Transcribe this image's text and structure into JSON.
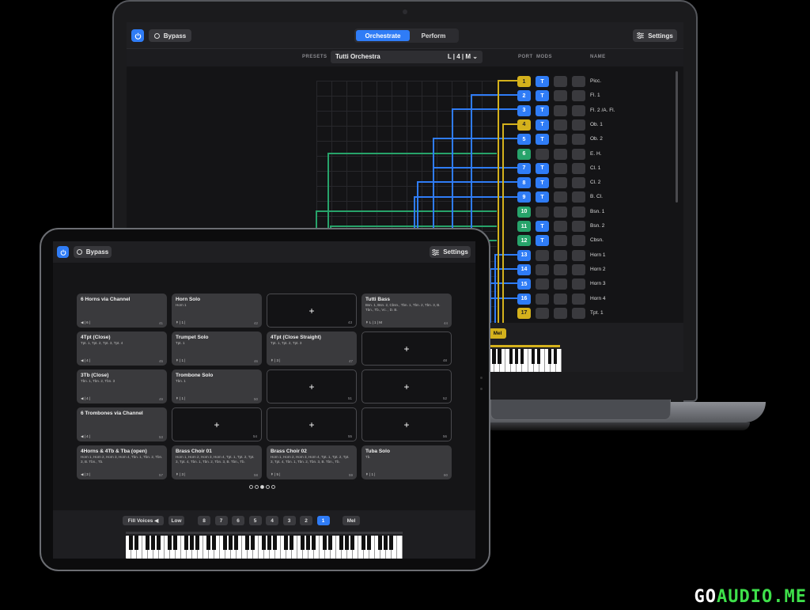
{
  "laptop": {
    "topbar": {
      "bypass_label": "Bypass",
      "tab_orchestrate": "Orchestrate",
      "tab_perform": "Perform",
      "settings_label": "Settings"
    },
    "subbar": {
      "presets_label": "PRESETS",
      "preset_name": "Tutti Orchestra",
      "preset_mode": "L | 4 | M",
      "col_port": "PORT",
      "col_mods": "MODS",
      "col_name": "NAME"
    },
    "rows": [
      {
        "port": "1",
        "color": "#d4b11c",
        "t": true,
        "name": "Picc."
      },
      {
        "port": "2",
        "color": "#2f7cf6",
        "t": true,
        "name": "Fl. 1"
      },
      {
        "port": "3",
        "color": "#2f7cf6",
        "t": true,
        "name": "Fl. 2 /A. Fl."
      },
      {
        "port": "4",
        "color": "#d4b11c",
        "t": true,
        "name": "Ob. 1"
      },
      {
        "port": "5",
        "color": "#2f7cf6",
        "t": true,
        "name": "Ob. 2"
      },
      {
        "port": "6",
        "color": "#27a36a",
        "t": false,
        "name": "E. H."
      },
      {
        "port": "7",
        "color": "#2f7cf6",
        "t": true,
        "name": "Cl. 1"
      },
      {
        "port": "8",
        "color": "#2f7cf6",
        "t": true,
        "name": "Cl. 2"
      },
      {
        "port": "9",
        "color": "#2f7cf6",
        "t": true,
        "name": "B. Cl."
      },
      {
        "port": "10",
        "color": "#27a36a",
        "t": false,
        "name": "Bsn. 1"
      },
      {
        "port": "11",
        "color": "#27a36a",
        "t": true,
        "name": "Bsn. 2"
      },
      {
        "port": "12",
        "color": "#27a36a",
        "t": true,
        "name": "Cbsn."
      },
      {
        "port": "13",
        "color": "#2f7cf6",
        "t": false,
        "name": "Horn 1"
      },
      {
        "port": "14",
        "color": "#2f7cf6",
        "t": false,
        "name": "Horn 2"
      },
      {
        "port": "15",
        "color": "#2f7cf6",
        "t": false,
        "name": "Horn 3"
      },
      {
        "port": "16",
        "color": "#2f7cf6",
        "t": false,
        "name": "Horn 4"
      },
      {
        "port": "17",
        "color": "#d4b11c",
        "t": false,
        "name": "Tpt. 1"
      }
    ],
    "mod_label": "T",
    "bottom": {
      "mel_label": "Mel"
    }
  },
  "tablet": {
    "topbar": {
      "bypass_label": "Bypass",
      "settings_label": "Settings"
    },
    "cards": [
      {
        "title": "6 Horns via Channel",
        "sub": "",
        "voices": "◀ | 6 |",
        "num": "41"
      },
      {
        "title": "Horn Solo",
        "sub": "Horn 1",
        "voices": "↟ | 1 |",
        "num": "42"
      },
      {
        "title": "",
        "sub": "",
        "voices": "",
        "num": "43",
        "empty": true
      },
      {
        "title": "Tutti Bass",
        "sub": "Bsn. 1, Bsn. 2, Cbsn., Tbn. 1, Tbn. 2, Tbn. 3, B. Tbn., Tb., Vc. , D. B.",
        "voices": "↟ L | 1 | M",
        "num": "44"
      },
      {
        "title": "4Tpt (Close)",
        "sub": "Tpt. 1, Tpt. 2, Tpt. 3, Tpt. 4",
        "voices": "◀ | 4 |",
        "num": "45"
      },
      {
        "title": "Trumpet Solo",
        "sub": "Tpt. 1",
        "voices": "↟ | 1 |",
        "num": "46"
      },
      {
        "title": "4Tpt (Close Straight)",
        "sub": "Tpt. 1, Tpt. 2, Tpt. 3",
        "voices": "↟ | 3 |",
        "num": "47"
      },
      {
        "title": "",
        "sub": "",
        "voices": "",
        "num": "48",
        "empty": true
      },
      {
        "title": "3Tb (Close)",
        "sub": "Tbn. 1, Tbn. 2, Tbn. 3",
        "voices": "◀ | 4 |",
        "num": "49"
      },
      {
        "title": "Trombone Solo",
        "sub": "Tbn. 1",
        "voices": "↟ | 1 |",
        "num": "50"
      },
      {
        "title": "",
        "sub": "",
        "voices": "",
        "num": "51",
        "empty": true
      },
      {
        "title": "",
        "sub": "",
        "voices": "",
        "num": "52",
        "empty": true
      },
      {
        "title": "6 Trombones via Channel",
        "sub": "",
        "voices": "◀ | 4 |",
        "num": "53"
      },
      {
        "title": "",
        "sub": "",
        "voices": "",
        "num": "54",
        "empty": true
      },
      {
        "title": "",
        "sub": "",
        "voices": "",
        "num": "55",
        "empty": true
      },
      {
        "title": "",
        "sub": "",
        "voices": "",
        "num": "56",
        "empty": true
      },
      {
        "title": "4Horns & 4Tb & Tba (open)",
        "sub": "Horn 1, Horn 2, Horn 3, Horn 4, Tbn. 1, Tbn. 2, Tbn. 3, B. Tbn., Tb.",
        "voices": "◀ | 3 |",
        "num": "57"
      },
      {
        "title": "Brass Choir 01",
        "sub": "Horn 1, Horn 2, Horn 3, Horn 4, Tpt. 1, Tpt. 2, Tpt. 3, Tpt. 4, Tbn. 1, Tbn. 2, Tbn. 3, B. Tbn., Tb.",
        "voices": "↟ | 3 |",
        "num": "58"
      },
      {
        "title": "Brass Choir 02",
        "sub": "Horn 1, Horn 2, Horn 3, Horn 4, Tpt. 1, Tpt. 2, Tpt. 3, Tpt. 4, Tbn. 1, Tbn. 2, Tbn. 3, B. Tbn., Tb.",
        "voices": "↟ | 5 |",
        "num": "59"
      },
      {
        "title": "Tuba Solo",
        "sub": "Tb.",
        "voices": "↟ | 1 |",
        "num": "60"
      }
    ],
    "bottom": {
      "fill_voices": "Fill Voices",
      "low": "Low",
      "voice_buttons": [
        "8",
        "7",
        "6",
        "5",
        "4",
        "3",
        "2",
        "1"
      ],
      "mel": "Mel"
    }
  },
  "watermark": {
    "prefix": "GO",
    "suffix": "AUDIO.ME"
  }
}
